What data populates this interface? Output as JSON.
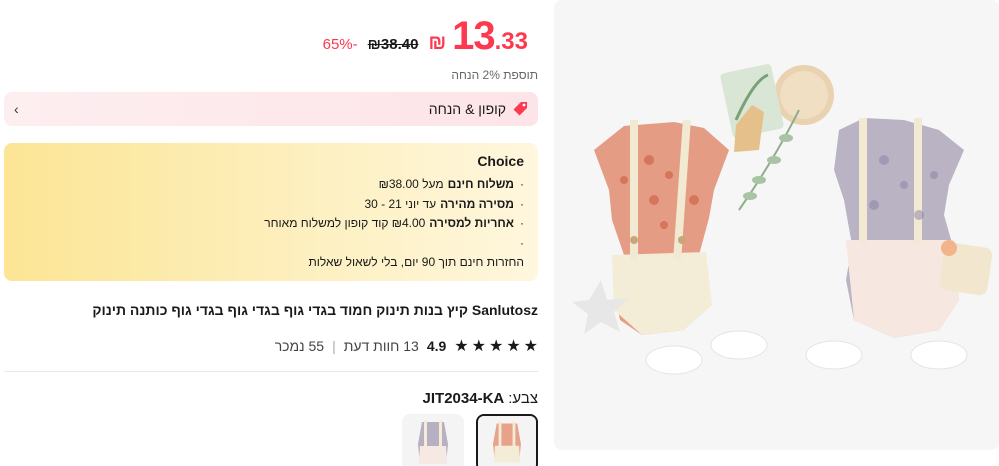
{
  "price": {
    "currency": "₪",
    "integer": "13",
    "decimal": ".33",
    "original": "₪38.40",
    "discount": "65%-",
    "extra_discount": "תוספת 2% הנחה"
  },
  "coupon": {
    "label": "קופון & הנחה",
    "chevron": "‹"
  },
  "choice": {
    "title": "Choice",
    "lines": [
      {
        "bold": "משלוח חינם",
        "text": "מעל ₪38.00"
      },
      {
        "bold": "מסירה מהירה",
        "text": "עד יוני 21 - 30"
      },
      {
        "bold": "אחריות למסירה",
        "text": "₪4.00 קוד קופון למשלוח מאוחר"
      },
      {
        "bold": "",
        "text": ""
      },
      {
        "bold": "",
        "text": "החזרות חינם תוך 90 יום, בלי לשאול שאלות"
      }
    ]
  },
  "product": {
    "title": "Sanlutosz קיץ בנות תינוק חמוד בגדי גוף בגדי גוף בגדי גוף כותנה תינוק",
    "rating": "4.9",
    "reviews": "13 חוות דעת",
    "sold": "55 נמכר",
    "separator": "|",
    "color_label": "צבע:",
    "color_value": "JIT2034-KA"
  },
  "swatches": [
    {
      "name": "orange-floral",
      "selected": true
    },
    {
      "name": "lavender-floral",
      "selected": false
    }
  ],
  "colors": {
    "price_red": "#fd384f",
    "coupon_bg": "#fdeef0",
    "choice_bg": "#fce594",
    "photo_bg": "#f6f6f6"
  }
}
